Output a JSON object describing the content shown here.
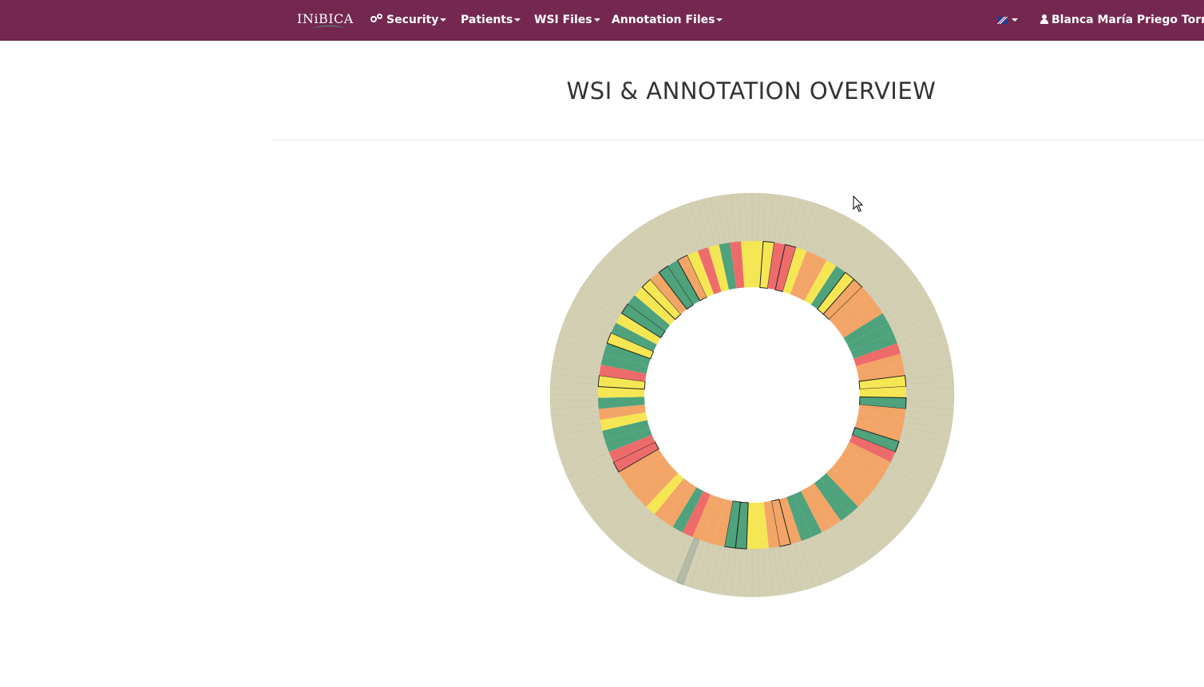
{
  "navbar": {
    "brand": "INiBICA",
    "items": [
      {
        "label": "Security",
        "icon": "gears-icon"
      },
      {
        "label": "Patients"
      },
      {
        "label": "WSI Files"
      },
      {
        "label": "Annotation Files"
      }
    ],
    "language_icon": "uk-flag-icon",
    "user": "Blanca María Priego Torres",
    "background_color": "#742850"
  },
  "page": {
    "title": "WSI & ANNOTATION OVERVIEW"
  },
  "sunburst": {
    "outer_ring_color": "#d3cfb3",
    "ring_colors": {
      "yellow": "#f5e654",
      "orange": "#f2a566",
      "red": "#ee6b6b",
      "green": "#4ea27c",
      "stone": "#d3cfb3"
    }
  }
}
